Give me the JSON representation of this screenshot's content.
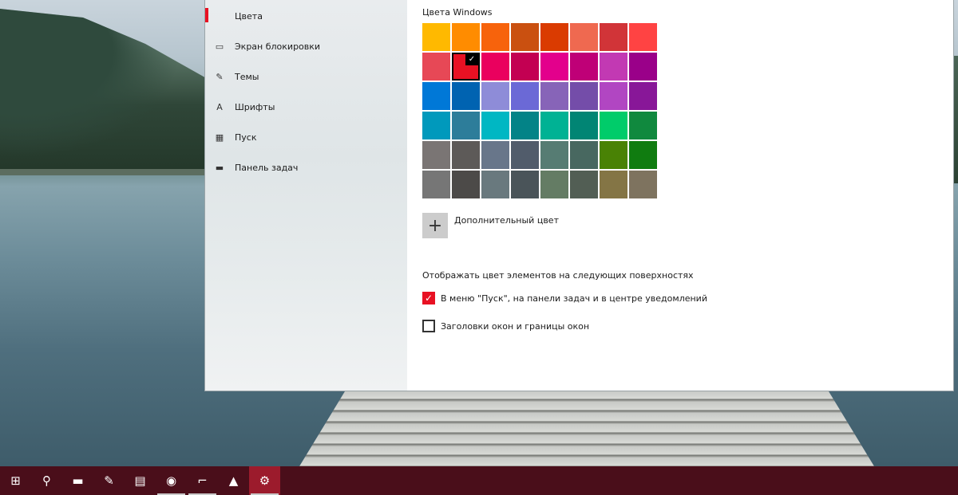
{
  "settings": {
    "nav": [
      {
        "label": "Цвета",
        "icon": "palette-icon",
        "active": true
      },
      {
        "label": "Экран блокировки",
        "icon": "lock-screen-icon",
        "active": false
      },
      {
        "label": "Темы",
        "icon": "themes-icon",
        "active": false
      },
      {
        "label": "Шрифты",
        "icon": "fonts-icon",
        "active": false
      },
      {
        "label": "Пуск",
        "icon": "start-icon",
        "active": false
      },
      {
        "label": "Панель задач",
        "icon": "taskbar-icon",
        "active": false
      }
    ],
    "section_title": "Цвета Windows",
    "swatches": [
      "#ffb900",
      "#ff8c00",
      "#f7630c",
      "#ca5010",
      "#da3b01",
      "#ef6950",
      "#d13438",
      "#ff4343",
      "#e74856",
      "#e81123",
      "#ea005e",
      "#c30052",
      "#e3008c",
      "#bf0077",
      "#c239b3",
      "#9a0089",
      "#0078d7",
      "#0063b1",
      "#8e8cd8",
      "#6b69d6",
      "#8764b8",
      "#744da9",
      "#b146c2",
      "#881798",
      "#0099bc",
      "#2d7d9a",
      "#00b7c3",
      "#038387",
      "#00b294",
      "#018574",
      "#00cc6a",
      "#10893e",
      "#7a7574",
      "#5d5a58",
      "#68768a",
      "#515c6b",
      "#567c73",
      "#486860",
      "#498205",
      "#107c10",
      "#767676",
      "#4c4a48",
      "#69797e",
      "#4a5459",
      "#647c64",
      "#525e54",
      "#847545",
      "#7e735f"
    ],
    "selected_swatch_index": 9,
    "custom_color_label": "Дополнительный цвет",
    "surfaces_title": "Отображать цвет элементов на следующих поверхностях",
    "options": [
      {
        "label": "В меню \"Пуск\", на панели задач и в центре уведомлений",
        "checked": true
      },
      {
        "label": "Заголовки окон и границы окон",
        "checked": false
      }
    ]
  },
  "taskbar": {
    "items": [
      {
        "name": "start-button",
        "icon": "windows-logo-icon",
        "glyph": "⊞",
        "running": false,
        "active": false
      },
      {
        "name": "search-button",
        "icon": "search-icon",
        "glyph": "⚲",
        "running": false,
        "active": false
      },
      {
        "name": "file-explorer-button",
        "icon": "folder-icon",
        "glyph": "▬",
        "running": false,
        "active": false
      },
      {
        "name": "paint-button",
        "icon": "paint-palette-icon",
        "glyph": "✎",
        "running": false,
        "active": false
      },
      {
        "name": "notepad-button",
        "icon": "notepad-icon",
        "glyph": "▤",
        "running": false,
        "active": false
      },
      {
        "name": "chrome-button",
        "icon": "chrome-icon",
        "glyph": "◉",
        "running": true,
        "active": false
      },
      {
        "name": "app-button",
        "icon": "bracket-app-icon",
        "glyph": "⌐",
        "running": true,
        "active": false
      },
      {
        "name": "aimp-button",
        "icon": "triangle-app-icon",
        "glyph": "▲",
        "running": false,
        "active": false
      },
      {
        "name": "settings-button",
        "icon": "gear-icon",
        "glyph": "⚙",
        "running": true,
        "active": true
      }
    ]
  }
}
